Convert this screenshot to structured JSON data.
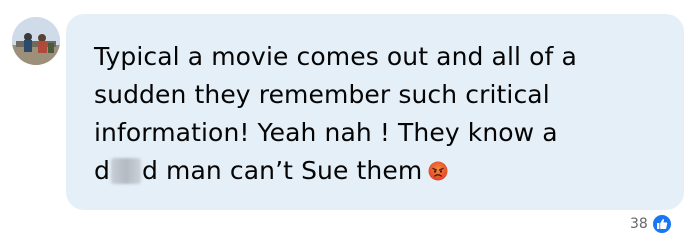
{
  "comment": {
    "avatar_icon": "profile-avatar",
    "line1": "Typical a movie comes out and all of a",
    "line2": "sudden they remember such critical",
    "line3": "information! Yeah nah ! They know a",
    "line4_prefix": "d",
    "line4_suffix": "d man can’t Sue them",
    "emoji": "angry-face-emoji",
    "bubble_color": "#e5eff8"
  },
  "reactions": {
    "count": "38",
    "icon": "like-thumbs-up-icon",
    "icon_color": "#1877f2"
  }
}
